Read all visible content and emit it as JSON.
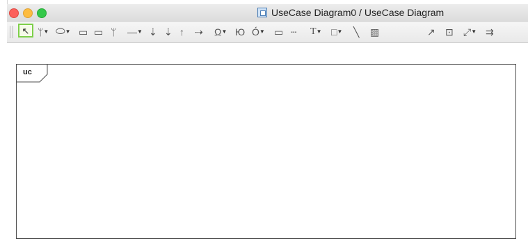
{
  "window": {
    "title": "UseCase Diagram0 / UseCase Diagram",
    "controls": [
      "close",
      "minimize",
      "zoom"
    ]
  },
  "toolbar": {
    "tools": [
      {
        "icon": "pointer-icon",
        "glyph": "↖",
        "selected": true
      },
      {
        "icon": "actor-icon",
        "glyph": "🯅",
        "dropdown": true
      },
      {
        "icon": "usecase-icon",
        "glyph": "⬭",
        "dropdown": true
      },
      {
        "icon": "package-icon",
        "glyph": "🗀"
      },
      {
        "icon": "subsystem-icon",
        "glyph": "🗀"
      },
      {
        "icon": "pin-icon",
        "glyph": "⚲"
      },
      {
        "icon": "association-icon",
        "glyph": "—",
        "dropdown": true
      },
      {
        "icon": "extend-icon",
        "glyph": "⭳"
      },
      {
        "icon": "include-icon",
        "glyph": "⭳"
      },
      {
        "icon": "generalization-icon",
        "glyph": "⇧"
      },
      {
        "icon": "dependency-icon",
        "glyph": "⇢"
      },
      {
        "icon": "boundary-icon",
        "glyph": "Ω",
        "dropdown": true
      },
      {
        "icon": "interface-icon",
        "glyph": "Ю"
      },
      {
        "icon": "lifeline-icon",
        "glyph": "Ó",
        "dropdown": true
      },
      {
        "icon": "note-icon",
        "glyph": "⌷"
      },
      {
        "icon": "note-link-icon",
        "glyph": "┄"
      },
      {
        "icon": "text-icon",
        "glyph": "T",
        "dropdown": true
      },
      {
        "icon": "rectangle-icon",
        "glyph": "□",
        "dropdown": true
      },
      {
        "icon": "line-icon",
        "glyph": "╲"
      },
      {
        "icon": "image-icon",
        "glyph": "▨"
      },
      {
        "icon": "pin-tool-icon",
        "glyph": "↗"
      },
      {
        "icon": "center-icon",
        "glyph": "⊡"
      },
      {
        "icon": "connector-icon",
        "glyph": "⤢",
        "dropdown": true
      },
      {
        "icon": "more-icon",
        "glyph": "⇉"
      }
    ]
  },
  "diagram": {
    "frame_label": "uc"
  }
}
